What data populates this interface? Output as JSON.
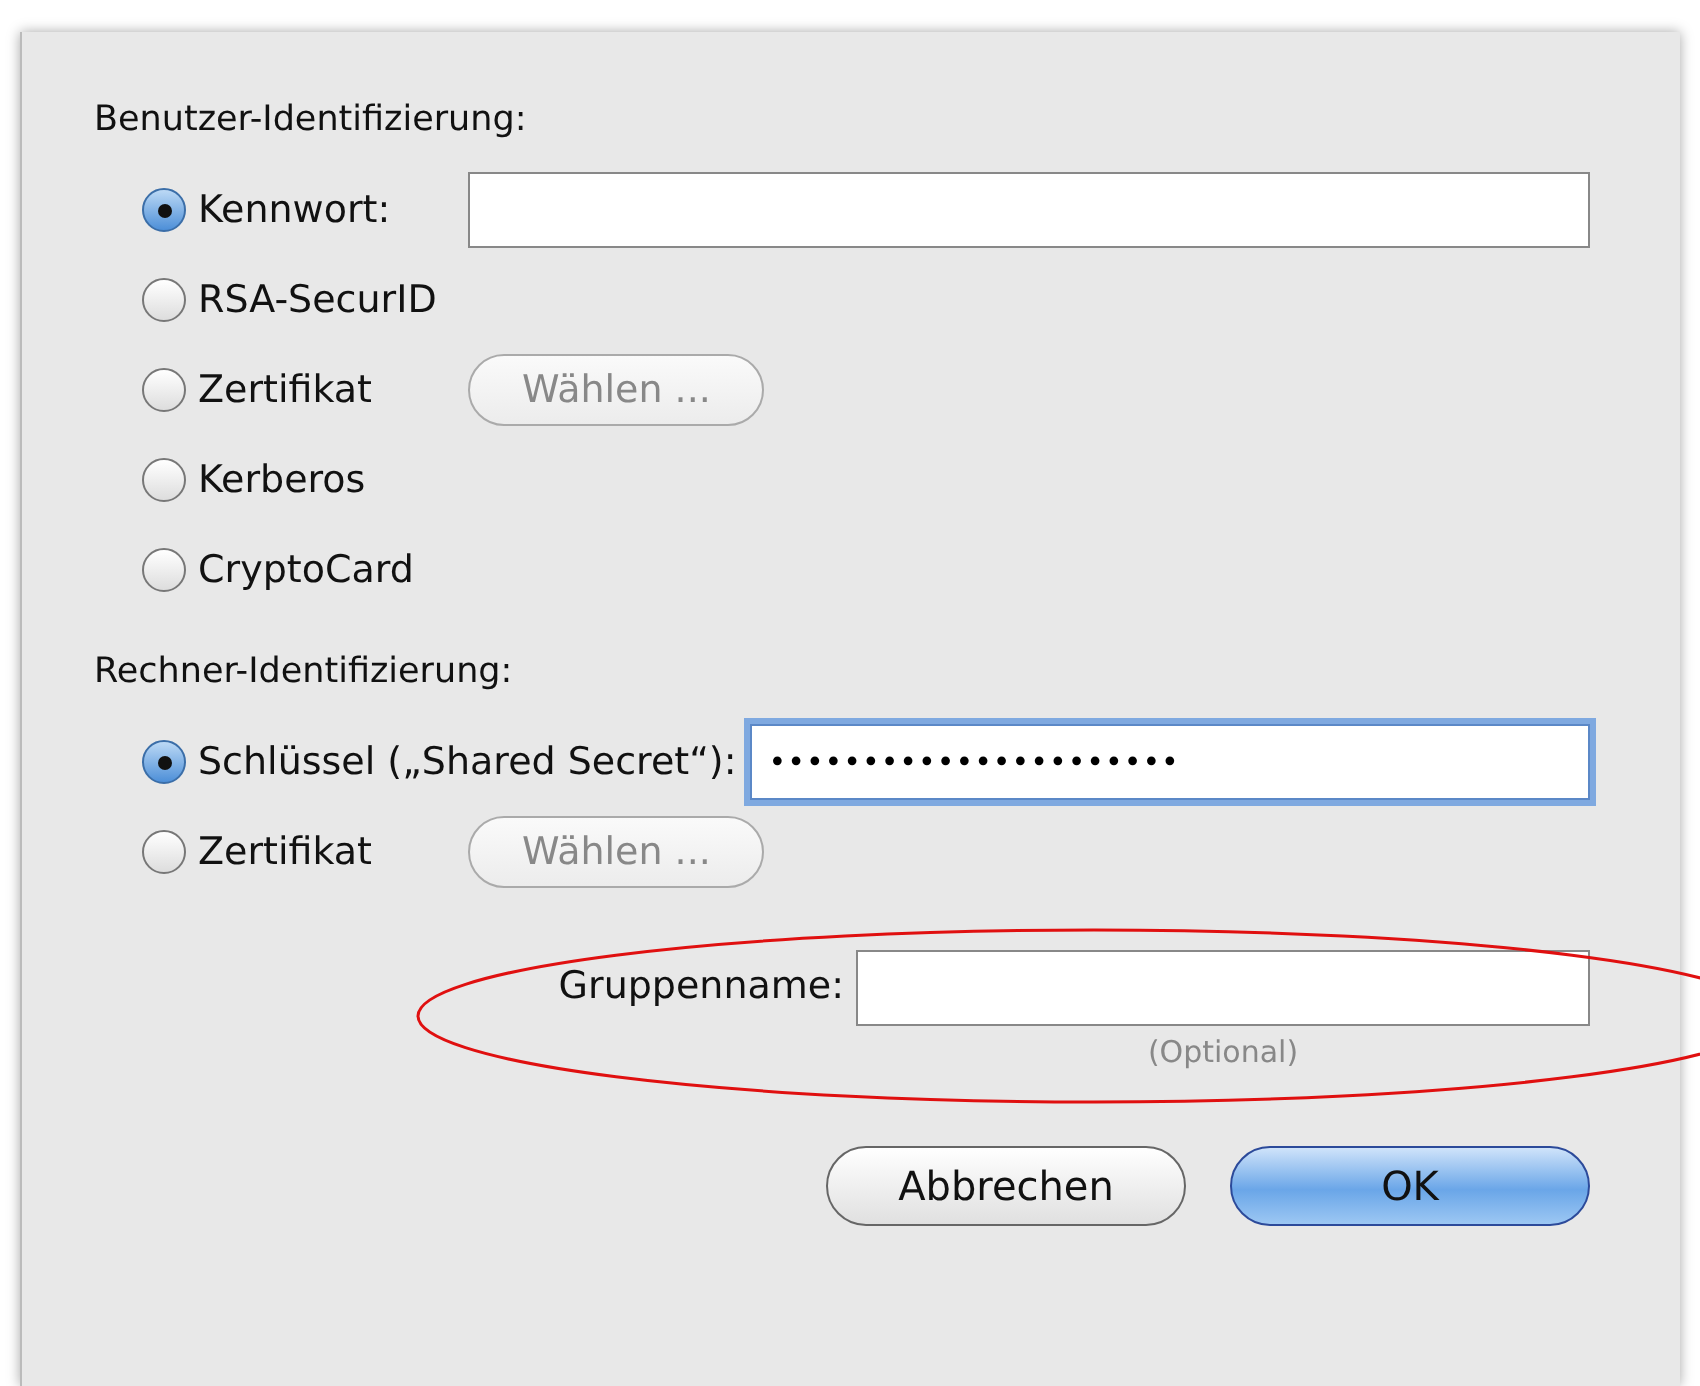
{
  "user_auth": {
    "label": "Benutzer-Identifizierung:",
    "options": [
      {
        "label": "Kennwort:",
        "selected": true,
        "kind": "field",
        "focused": false
      },
      {
        "label": "RSA-SecurID",
        "selected": false,
        "kind": "plain"
      },
      {
        "label": "Zertifikat",
        "selected": false,
        "kind": "button",
        "button": "Wählen ..."
      },
      {
        "label": "Kerberos",
        "selected": false,
        "kind": "plain"
      },
      {
        "label": "CryptoCard",
        "selected": false,
        "kind": "plain"
      }
    ]
  },
  "machine_auth": {
    "label": "Rechner-Identifizierung:",
    "options": [
      {
        "label": "Schlüssel („Shared Secret“):",
        "selected": true,
        "kind": "field",
        "focused": true,
        "value": "••••••••••••••••••••••"
      },
      {
        "label": "Zertifikat",
        "selected": false,
        "kind": "button",
        "button": "Wählen ..."
      }
    ]
  },
  "group": {
    "label": "Gruppenname:",
    "hint": "(Optional)"
  },
  "buttons": [
    {
      "label": "Abbrechen",
      "default": false
    },
    {
      "label": "OK",
      "default": true
    }
  ]
}
